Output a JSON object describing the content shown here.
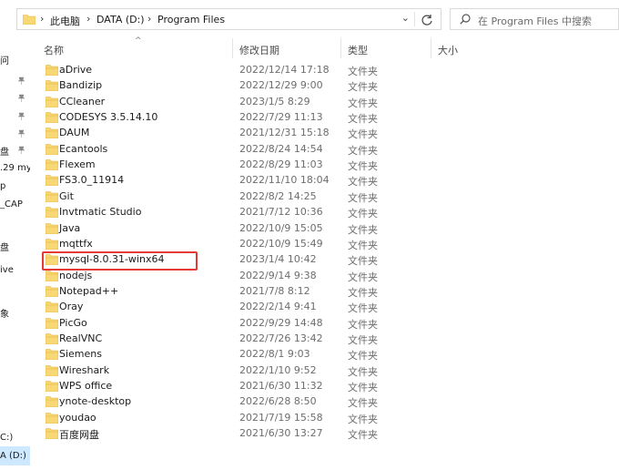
{
  "address_bar": {
    "crumbs": [
      "此电脑",
      "DATA (D:)",
      "Program Files"
    ]
  },
  "search": {
    "placeholder": "在 Program Files 中搜索"
  },
  "nav_pane": {
    "items": [
      "问",
      "盘",
      ".29 my",
      "p",
      "_CAP",
      "盘",
      "ive",
      "象",
      "C:)",
      "A (D:)"
    ]
  },
  "columns": {
    "name": "名称",
    "modified": "修改日期",
    "type": "类型",
    "size": "大小"
  },
  "files": [
    {
      "name": "aDrive",
      "date": "2022/12/14 17:18",
      "type": "文件夹"
    },
    {
      "name": "Bandizip",
      "date": "2022/12/29 9:00",
      "type": "文件夹"
    },
    {
      "name": "CCleaner",
      "date": "2023/1/5 8:29",
      "type": "文件夹"
    },
    {
      "name": "CODESYS 3.5.14.10",
      "date": "2022/7/29 11:13",
      "type": "文件夹"
    },
    {
      "name": "DAUM",
      "date": "2021/12/31 15:18",
      "type": "文件夹"
    },
    {
      "name": "Ecantools",
      "date": "2022/8/24 14:54",
      "type": "文件夹"
    },
    {
      "name": "Flexem",
      "date": "2022/8/29 11:03",
      "type": "文件夹"
    },
    {
      "name": "FS3.0_11914",
      "date": "2022/11/10 18:04",
      "type": "文件夹"
    },
    {
      "name": "Git",
      "date": "2022/8/2 14:25",
      "type": "文件夹"
    },
    {
      "name": "Invtmatic Studio",
      "date": "2021/7/12 10:36",
      "type": "文件夹"
    },
    {
      "name": "Java",
      "date": "2022/10/9 15:05",
      "type": "文件夹"
    },
    {
      "name": "mqttfx",
      "date": "2022/10/9 15:49",
      "type": "文件夹"
    },
    {
      "name": "mysql-8.0.31-winx64",
      "date": "2023/1/4 10:42",
      "type": "文件夹"
    },
    {
      "name": "nodejs",
      "date": "2022/9/14 9:38",
      "type": "文件夹"
    },
    {
      "name": "Notepad++",
      "date": "2021/7/8 8:12",
      "type": "文件夹"
    },
    {
      "name": "Oray",
      "date": "2022/2/14 9:41",
      "type": "文件夹"
    },
    {
      "name": "PicGo",
      "date": "2022/9/29 14:48",
      "type": "文件夹"
    },
    {
      "name": "RealVNC",
      "date": "2022/7/26 13:42",
      "type": "文件夹"
    },
    {
      "name": "Siemens",
      "date": "2022/8/1 9:03",
      "type": "文件夹"
    },
    {
      "name": "Wireshark",
      "date": "2022/1/10 9:52",
      "type": "文件夹"
    },
    {
      "name": "WPS office",
      "date": "2021/6/30 11:32",
      "type": "文件夹"
    },
    {
      "name": "ynote-desktop",
      "date": "2022/6/28 8:50",
      "type": "文件夹"
    },
    {
      "name": "youdao",
      "date": "2021/7/19 15:58",
      "type": "文件夹"
    },
    {
      "name": "百度网盘",
      "date": "2021/6/30 13:27",
      "type": "文件夹"
    }
  ],
  "colors": {
    "folder_yellow": "#f8d775",
    "folder_dark": "#e4b43c",
    "highlight_box": "#e53935",
    "nav_selected": "#cde8ff"
  }
}
